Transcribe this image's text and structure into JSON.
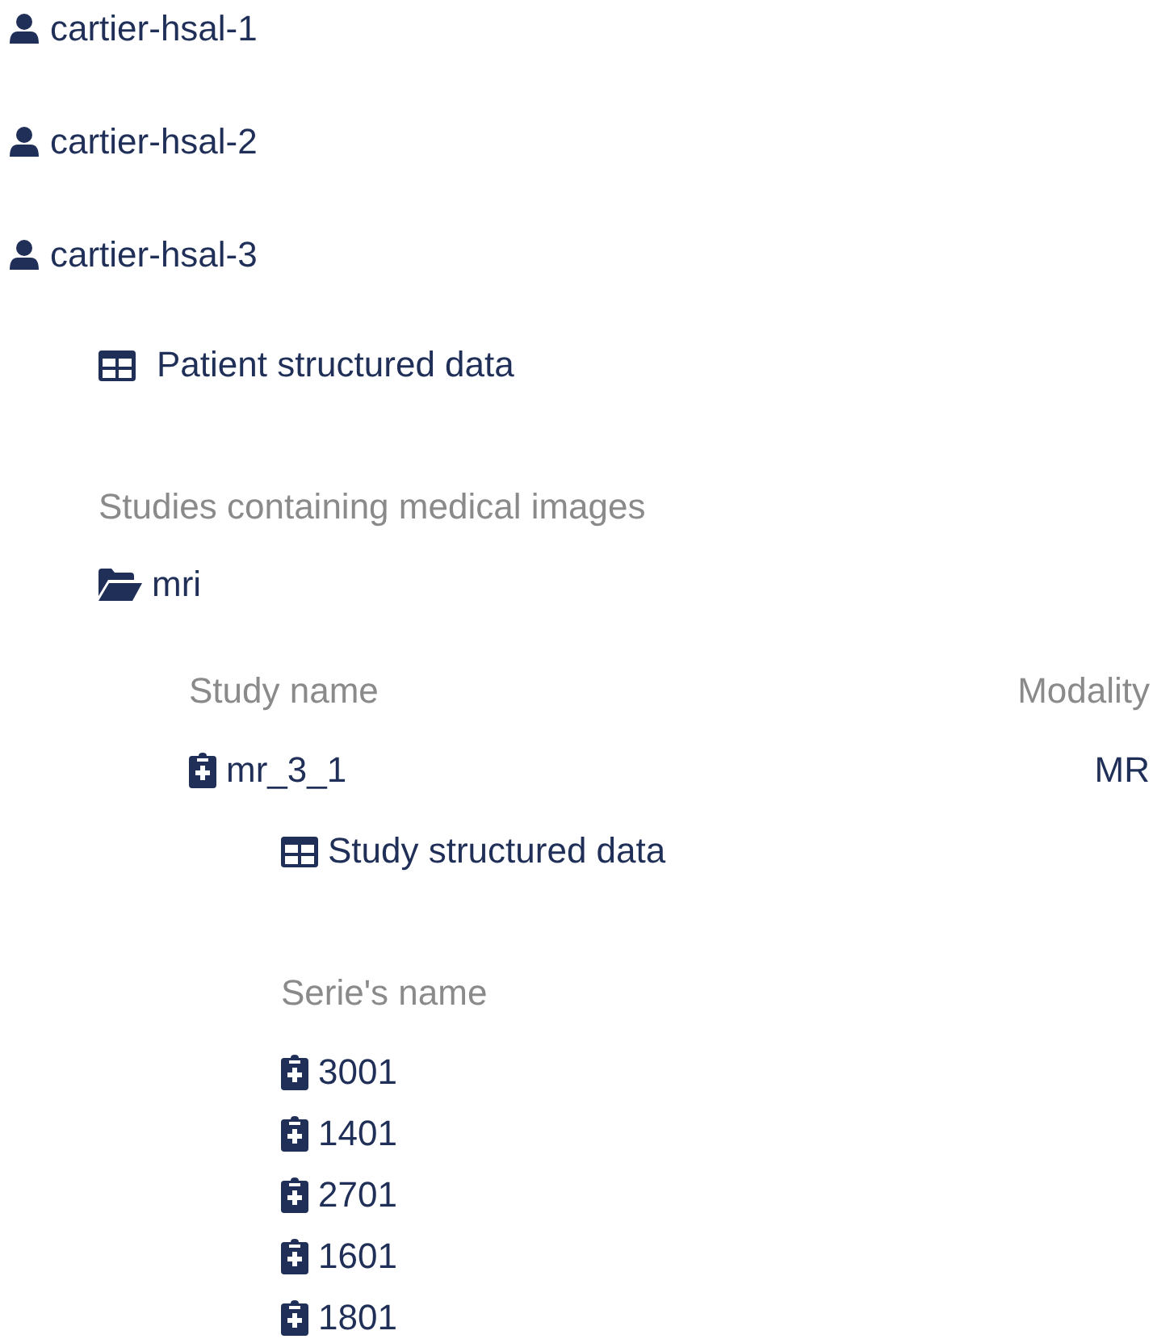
{
  "patients": [
    {
      "name": "cartier-hsal-1"
    },
    {
      "name": "cartier-hsal-2"
    },
    {
      "name": "cartier-hsal-3",
      "structured_data_link": "Patient structured data",
      "studies_heading": "Studies containing medical images",
      "folders": [
        {
          "name": "mri",
          "columns": [
            "Study name",
            "Modality"
          ],
          "studies": [
            {
              "name": "mr_3_1",
              "modality": "MR",
              "structured_data_link": "Study structured data",
              "series_heading": "Serie's name",
              "series": [
                "3001",
                "1401",
                "2701",
                "1601",
                "1801"
              ]
            }
          ]
        }
      ]
    }
  ]
}
